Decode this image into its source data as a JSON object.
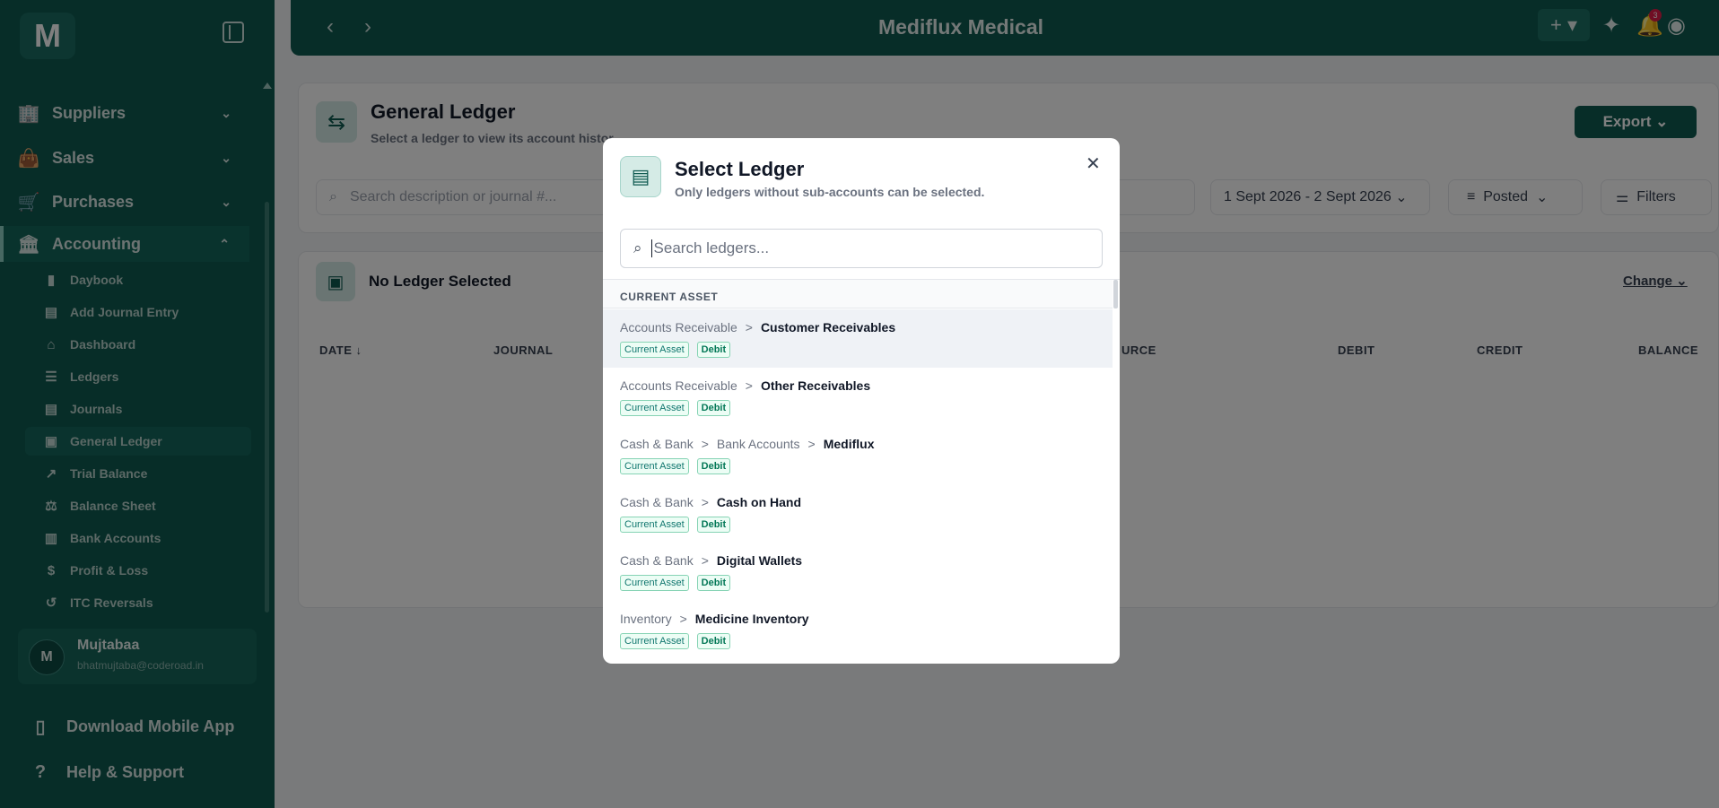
{
  "app": {
    "logo": "M",
    "title": "Mediflux Medical",
    "notif_count": "3"
  },
  "sidebar": {
    "top_items": [
      {
        "label": "Suppliers",
        "icon": "building-icon",
        "glyph": "🏢"
      },
      {
        "label": "Sales",
        "icon": "shopping-bag-icon",
        "glyph": "👜"
      },
      {
        "label": "Purchases",
        "icon": "cart-icon",
        "glyph": "🛒"
      },
      {
        "label": "Accounting",
        "icon": "bank-icon",
        "glyph": "🏛"
      }
    ],
    "sub_items": [
      {
        "label": "Daybook",
        "icon": "book-icon",
        "glyph": "▮"
      },
      {
        "label": "Add Journal Entry",
        "icon": "document-icon",
        "glyph": "▤"
      },
      {
        "label": "Dashboard",
        "icon": "home-icon",
        "glyph": "⌂"
      },
      {
        "label": "Ledgers",
        "icon": "list-icon",
        "glyph": "☰"
      },
      {
        "label": "Journals",
        "icon": "file-icon",
        "glyph": "▤"
      },
      {
        "label": "General Ledger",
        "icon": "ledger-icon",
        "glyph": "▣"
      },
      {
        "label": "Trial Balance",
        "icon": "chart-line-icon",
        "glyph": "↗"
      },
      {
        "label": "Balance Sheet",
        "icon": "scale-icon",
        "glyph": "⚖"
      },
      {
        "label": "Bank Accounts",
        "icon": "bank-building-icon",
        "glyph": "▥"
      },
      {
        "label": "Profit & Loss",
        "icon": "dollar-circle-icon",
        "glyph": "$"
      },
      {
        "label": "ITC Reversals",
        "icon": "undo-icon",
        "glyph": "↺"
      }
    ],
    "user": {
      "initial": "M",
      "name": "Mujtabaa",
      "email": "bhatmujtaba@coderoad.in"
    },
    "bottom_items": [
      {
        "label": "Download Mobile App",
        "icon": "phone-icon",
        "glyph": "▯"
      },
      {
        "label": "Help & Support",
        "icon": "help-icon",
        "glyph": "?"
      }
    ]
  },
  "page": {
    "title": "General Ledger",
    "subtitle": "Select a ledger to view its account histor",
    "export_label": "Export",
    "search_placeholder": "Search description or journal #...",
    "date_range": "1 Sept 2026 - 2 Sept 2026",
    "status_filter": "Posted",
    "filters_label": "Filters",
    "no_ledger": "No Ledger Selected",
    "change_label": "Change",
    "columns": [
      "DATE",
      "JOURNAL",
      "URCE",
      "DEBIT",
      "CREDIT",
      "BALANCE"
    ]
  },
  "modal": {
    "title": "Select Ledger",
    "subtitle": "Only ledgers without sub-accounts can be selected.",
    "search_placeholder": "Search ledgers...",
    "group": "CURRENT ASSET",
    "rows": [
      {
        "path": [
          "Accounts Receivable"
        ],
        "leaf": "Customer Receivables",
        "type": "Current Asset",
        "nature": "Debit"
      },
      {
        "path": [
          "Accounts Receivable"
        ],
        "leaf": "Other Receivables",
        "type": "Current Asset",
        "nature": "Debit"
      },
      {
        "path": [
          "Cash & Bank",
          "Bank Accounts"
        ],
        "leaf": "Mediflux",
        "type": "Current Asset",
        "nature": "Debit"
      },
      {
        "path": [
          "Cash & Bank"
        ],
        "leaf": "Cash on Hand",
        "type": "Current Asset",
        "nature": "Debit"
      },
      {
        "path": [
          "Cash & Bank"
        ],
        "leaf": "Digital Wallets",
        "type": "Current Asset",
        "nature": "Debit"
      },
      {
        "path": [
          "Inventory"
        ],
        "leaf": "Medicine Inventory",
        "type": "Current Asset",
        "nature": "Debit"
      }
    ],
    "separator": ">"
  },
  "colors": {
    "brand": "#0f5a50",
    "tag_border": "#86d3b4"
  }
}
